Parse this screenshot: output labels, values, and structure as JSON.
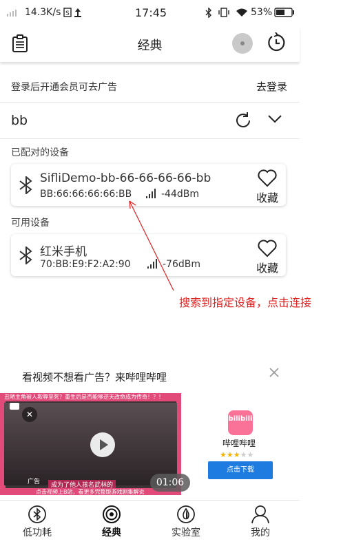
{
  "status_bar": {
    "speed": "14.3K/s",
    "time": "17:45",
    "battery": "53%"
  },
  "header": {
    "title": "经典"
  },
  "login": {
    "text": "登录后开通会员可去广告",
    "action": "去登录"
  },
  "filter": {
    "value": "bb"
  },
  "paired": {
    "label": "已配对的设备",
    "devices": [
      {
        "name": "SifliDemo-bb-66-66-66-66-bb",
        "mac": "BB:66:66:66:66:BB",
        "rssi": "-44dBm",
        "fav": "收藏"
      }
    ]
  },
  "available": {
    "label": "可用设备",
    "devices": [
      {
        "name": "红米手机",
        "mac": "70:BB:E9:F2:A2:90",
        "rssi": "-76dBm",
        "fav": "收藏"
      }
    ]
  },
  "annotation": "搜索到指定设备，点击连接",
  "ad": {
    "title": "看视频不想看广告？来哔哩哔哩",
    "video_top_caption": "丑陋主角被人欺辱至死？重生后是否能够逆天改命成为传奇！？！",
    "video_sub1": "成为了他人孩名武林的",
    "video_sub2": "点击视频上B站，看更多完整版游戏剧集解说",
    "ad_tag": "广告",
    "duration": "01:06",
    "app_icon_text": "bilibili",
    "app_name": "哔哩哔哩",
    "rating": 3,
    "download": "点击下载"
  },
  "nav": {
    "items": [
      {
        "label": "低功耗",
        "icon": "bluetooth-icon"
      },
      {
        "label": "经典",
        "icon": "signal-icon"
      },
      {
        "label": "实验室",
        "icon": "lab-icon"
      },
      {
        "label": "我的",
        "icon": "profile-icon"
      }
    ]
  },
  "colors": {
    "annotation": "#e02020",
    "download_button": "#1e7be0",
    "bili_pink": "#fb7299"
  }
}
